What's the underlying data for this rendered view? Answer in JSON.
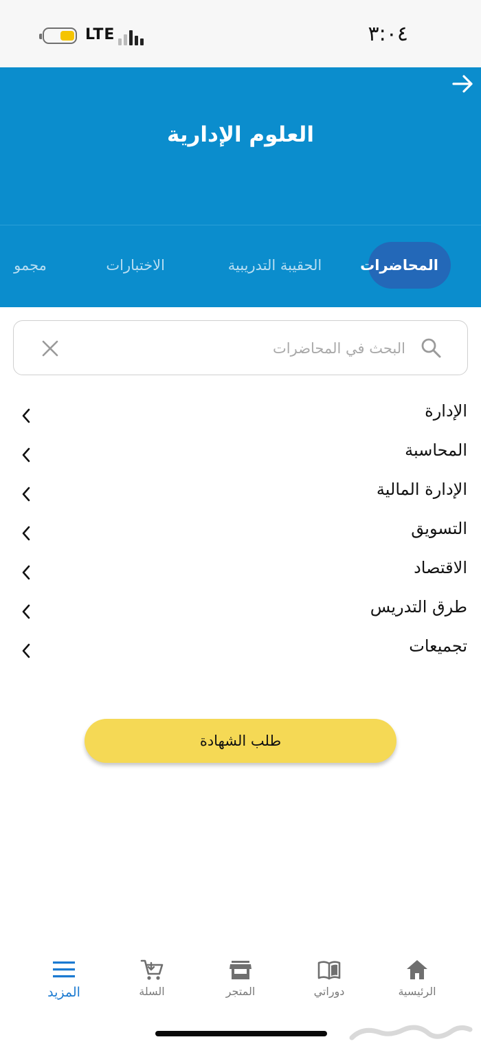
{
  "status_bar": {
    "time": "٣:٠٤",
    "network": "LTE",
    "battery_icon": "battery-icon",
    "signal_icon": "signal-icon"
  },
  "header": {
    "title": "العلوم الإدارية",
    "back_icon": "arrow-right-icon"
  },
  "tabs": [
    {
      "label": "المحاضرات",
      "active": true
    },
    {
      "label": "الحقيبة التدريبية",
      "active": false
    },
    {
      "label": "الاختبارات",
      "active": false
    },
    {
      "label": "مجمو",
      "active": false
    }
  ],
  "search": {
    "placeholder": "البحث في المحاضرات",
    "value": "",
    "icon": "search-icon",
    "clear_icon": "close-icon"
  },
  "categories": [
    {
      "label": "الإدارة"
    },
    {
      "label": "المحاسبة"
    },
    {
      "label": "الإدارة المالية"
    },
    {
      "label": "التسويق"
    },
    {
      "label": "الاقتصاد"
    },
    {
      "label": "طرق التدريس"
    },
    {
      "label": "تجميعات"
    }
  ],
  "certificate_button": {
    "label": "طلب الشهادة"
  },
  "bottom_nav": [
    {
      "label": "الرئيسية",
      "icon": "home-icon",
      "active": false
    },
    {
      "label": "دوراتي",
      "icon": "book-icon",
      "active": false
    },
    {
      "label": "المتجر",
      "icon": "store-icon",
      "active": false
    },
    {
      "label": "السلة",
      "icon": "cart-icon",
      "active": false
    },
    {
      "label": "المزيد",
      "icon": "menu-icon",
      "active": true
    }
  ],
  "watermark": "حراج",
  "colors": {
    "header_bg": "#0b8dcd",
    "active_tab_bg": "#2368b8",
    "button_bg": "#f5d955",
    "nav_active": "#1b7ad1"
  }
}
